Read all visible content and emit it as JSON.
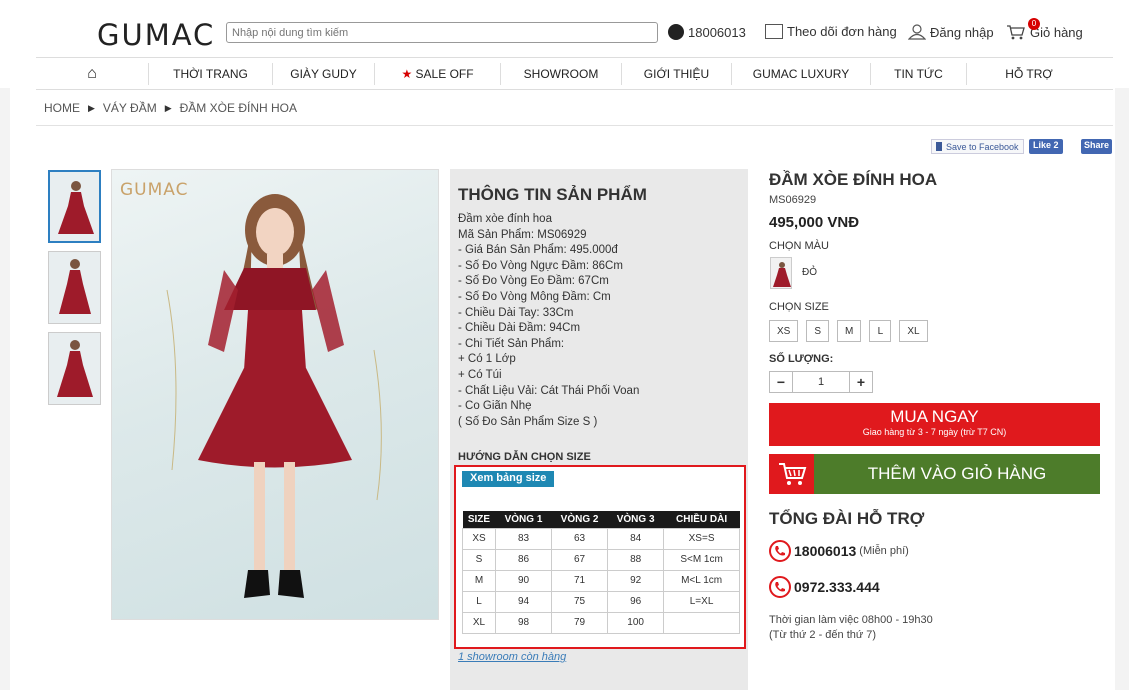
{
  "header": {
    "logo": "GUMAC",
    "search_placeholder": "Nhập nội dung tìm kiếm",
    "phone": "18006013",
    "track_order": "Theo dõi đơn hàng",
    "login": "Đăng nhập",
    "cart": "Giỏ hàng",
    "cart_count": "0"
  },
  "nav": {
    "items": [
      "THỜI TRANG",
      "GIÀY GUDY",
      "SALE OFF",
      "SHOWROOM",
      "GIỚI THIỆU",
      "GUMAC LUXURY",
      "TIN TỨC",
      "HỖ TRỢ"
    ]
  },
  "breadcrumb": [
    "HOME",
    "VÁY ĐẦM",
    "ĐẦM XÒE ĐÍNH HOA"
  ],
  "social": {
    "save": "Save to Facebook",
    "like": "Like 2",
    "share": "Share"
  },
  "gallery": {
    "watermark": "GUMAC"
  },
  "info": {
    "title": "THÔNG TIN SẢN PHẨM",
    "lines": [
      "Đầm xòe đính hoa",
      "Mã Sản Phẩm: MS06929",
      "- Giá Bán Sản Phẩm: 495.000đ",
      "- Số Đo Vòng Ngực Đầm: 86Cm",
      "- Số Đo Vòng Eo Đầm: 67Cm",
      "- Số Đo Vòng Mông Đầm: Cm",
      "- Chiều Dài Tay: 33Cm",
      "- Chiều Dài Đầm: 94Cm",
      "- Chi Tiết Sản Phẩm:",
      "+ Có 1 Lớp",
      "+ Có Túi",
      "- Chất Liệu Vải: Cát Thái Phối Voan",
      "- Co Giãn Nhẹ",
      "( Số Đo Sản Phẩm Size S )"
    ],
    "guide_title": "HƯỚNG DẪN CHỌN SIZE",
    "size_button": "Xem bảng size",
    "table": {
      "headers": [
        "SIZE",
        "VÒNG 1",
        "VÒNG 2",
        "VÒNG 3",
        "CHIỀU DÀI"
      ],
      "rows": [
        [
          "XS",
          "83",
          "63",
          "84",
          "XS=S"
        ],
        [
          "S",
          "86",
          "67",
          "88",
          "S<M 1cm"
        ],
        [
          "M",
          "90",
          "71",
          "92",
          "M<L 1cm"
        ],
        [
          "L",
          "94",
          "75",
          "96",
          "L=XL"
        ],
        [
          "XL",
          "98",
          "79",
          "100",
          ""
        ]
      ]
    },
    "showroom": "1 showroom còn hàng"
  },
  "product": {
    "title": "ĐẦM XÒE ĐÍNH HOA",
    "code": "MS06929",
    "price": "495,000 VNĐ",
    "color_label": "CHỌN MÀU",
    "color_name": "ĐỎ",
    "size_label": "CHỌN SIZE",
    "sizes": [
      "XS",
      "S",
      "M",
      "L",
      "XL"
    ],
    "qty_label": "SỐ LƯỢNG:",
    "qty": "1",
    "qty_minus": "−",
    "qty_plus": "+",
    "buy_now": "MUA NGAY",
    "buy_note": "Giao hàng từ 3 - 7 ngày (trừ T7 CN)",
    "add_cart": "THÊM VÀO GIỎ HÀNG"
  },
  "support": {
    "title": "TỔNG ĐÀI HỖ TRỢ",
    "hotline1": "18006013",
    "hotline1_note": "(Miễn phí)",
    "hotline2": "0972.333.444",
    "hours1": "Thời gian làm việc 08h00 - 19h30",
    "hours2": "(Từ thứ 2 - đến thứ 7)"
  },
  "colors": {
    "accent_red": "#e0191d",
    "cart_green": "#4d7c2a",
    "dress": "#9e1b2a",
    "link_blue": "#3a7cb8"
  }
}
